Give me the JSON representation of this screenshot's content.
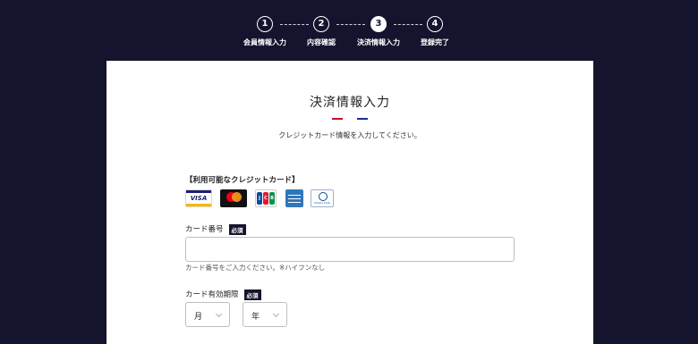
{
  "stepper": {
    "steps": [
      {
        "number": "1",
        "label": "会員情報入力"
      },
      {
        "number": "2",
        "label": "内容確認"
      },
      {
        "number": "3",
        "label": "決済情報入力"
      },
      {
        "number": "4",
        "label": "登録完了"
      }
    ],
    "active_step": 3
  },
  "card": {
    "title": "決済情報入力",
    "subtitle": "クレジットカード情報を入力してください。",
    "accent_colors": [
      "#c8102e",
      "#ffffff",
      "#1a2f8a"
    ]
  },
  "available_cards": {
    "label": "【利用可能なクレジットカード】",
    "brands": [
      {
        "name": "VISA",
        "icon": "visa-icon"
      },
      {
        "name": "Mastercard",
        "icon": "mastercard-icon"
      },
      {
        "name": "JCB",
        "icon": "jcb-icon"
      },
      {
        "name": "American Express",
        "icon": "amex-icon"
      },
      {
        "name": "Diners Club",
        "icon": "diners-icon"
      }
    ],
    "visa_text": "VISA",
    "jcb_letters": [
      "J",
      "C",
      "B"
    ],
    "diners_text": "Diners Club"
  },
  "form": {
    "card_number": {
      "label": "カード番号",
      "required_badge": "必須",
      "value": "",
      "placeholder": "",
      "hint": "カード番号をご入力ください。※ハイフンなし"
    },
    "expiry": {
      "label": "カード有効期限",
      "required_badge": "必須",
      "month_value": "月",
      "year_value": "年"
    }
  },
  "colors": {
    "background": "#14142e",
    "badge": "#14142e"
  }
}
